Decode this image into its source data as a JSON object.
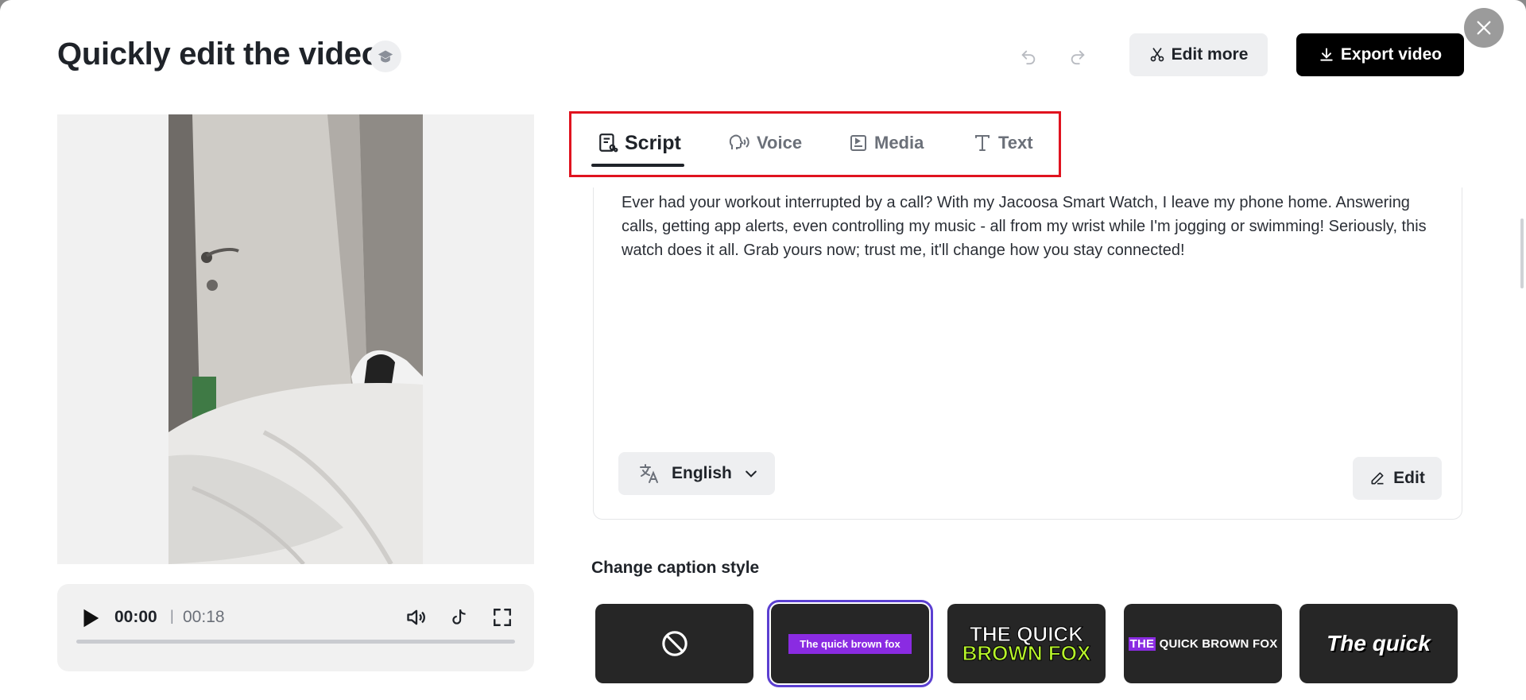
{
  "header": {
    "title": "Quickly edit the video",
    "edit_more_label": "Edit more",
    "export_label": "Export video"
  },
  "player": {
    "current_time": "00:00",
    "separator": "|",
    "total_time": "00:18",
    "progress": 0
  },
  "tabs": [
    {
      "label": "Script",
      "icon": "script-icon",
      "active": true
    },
    {
      "label": "Voice",
      "icon": "voice-icon",
      "active": false
    },
    {
      "label": "Media",
      "icon": "media-icon",
      "active": false
    },
    {
      "label": "Text",
      "icon": "text-icon",
      "active": false
    }
  ],
  "script": {
    "text": "Ever had your workout interrupted by a call? With my Jacoosa Smart Watch, I leave my phone home. Answering calls, getting app alerts, even controlling my music - all from my wrist while I'm jogging or swimming! Seriously, this watch does it all. Grab yours now; trust me, it'll change how you stay connected!",
    "language": "English",
    "edit_label": "Edit"
  },
  "captions": {
    "heading": "Change caption style",
    "styles": [
      {
        "name": "none",
        "label": ""
      },
      {
        "name": "purple-highlight",
        "label": "The quick brown fox",
        "selected": true
      },
      {
        "name": "bold-green",
        "line1": "THE QUICK",
        "line2": "BROWN FOX"
      },
      {
        "name": "small-highlight",
        "highlight": "THE",
        "rest": " QUICK BROWN FOX"
      },
      {
        "name": "italic",
        "label": "The quick"
      }
    ]
  },
  "colors": {
    "accent_highlight": "#e0131f",
    "caption_purple": "#8a2be2",
    "caption_green": "#b7f52b",
    "selected_outline": "#5b3fd1"
  }
}
